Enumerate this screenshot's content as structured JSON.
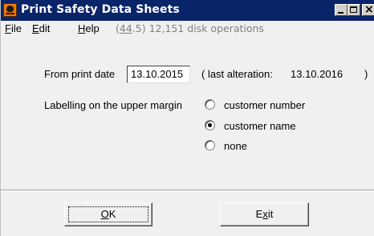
{
  "window": {
    "title": "Print Safety Data Sheets",
    "icon": "hazard-skull-icon",
    "controls": {
      "minimize": "minimize-icon",
      "maximize": "maximize-icon",
      "close": "×"
    }
  },
  "menubar": {
    "items": [
      {
        "label": "File",
        "mnemonic": "F",
        "rest": "ile"
      },
      {
        "label": "Edit",
        "mnemonic": "E",
        "rest": "dit"
      },
      {
        "label": "Help",
        "mnemonic": "H",
        "rest": "elp"
      }
    ],
    "status_prefix": "(",
    "status_number": "44",
    "status_suffix": ".5) 12,151 disk operations"
  },
  "form": {
    "from_print_date_label": "From print date",
    "from_print_date_value": "13.10.2015",
    "last_alteration_label": "( last alteration:",
    "last_alteration_value": "13.10.2016",
    "last_alteration_close": ")",
    "labelling_label": "Labelling on the upper margin",
    "labelling_options": [
      {
        "label": "customer number",
        "checked": false
      },
      {
        "label": "customer name",
        "checked": true
      },
      {
        "label": "none",
        "checked": false
      }
    ]
  },
  "buttons": {
    "ok_mnemonic": "O",
    "ok_rest": "K",
    "exit_prefix": "E",
    "exit_mnemonic": "x",
    "exit_rest": "it"
  }
}
